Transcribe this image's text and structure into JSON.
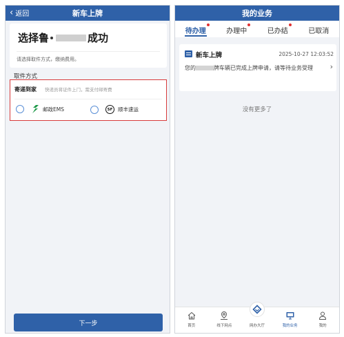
{
  "left": {
    "header": {
      "back_label": "返回",
      "title": "新车上牌"
    },
    "result": {
      "title_prefix": "选择鲁",
      "title_suffix": "成功",
      "subtitle": "请选择取件方式，缴纳费用。"
    },
    "section_label": "取件方式",
    "method": {
      "title": "寄递到家",
      "hint": "快递员将证件上门，需支付邮寄费",
      "options": [
        {
          "label": "邮政EMS",
          "icon": "ems-logo-icon"
        },
        {
          "label": "顺丰速运",
          "icon": "sf-logo-icon",
          "logo_text": "SF"
        }
      ]
    },
    "next_button": "下一步"
  },
  "right": {
    "header": {
      "title": "我的业务"
    },
    "tabs": [
      {
        "label": "待办理",
        "active": true,
        "badge": true
      },
      {
        "label": "办理中",
        "active": false,
        "badge": true
      },
      {
        "label": "已办结",
        "active": false,
        "badge": true
      },
      {
        "label": "已取消",
        "active": false,
        "badge": false
      }
    ],
    "business": {
      "title": "新车上牌",
      "time": "2025-10-27 12:03:52",
      "desc_prefix": "您的",
      "desc_suffix": "牌车辆已完成上牌申请，请等待业务受理"
    },
    "no_more": "没有更多了",
    "nav": [
      {
        "label": "首页",
        "icon": "home-icon"
      },
      {
        "label": "线下网点",
        "icon": "location-pin-icon"
      },
      {
        "label": "网办大厅",
        "icon": "diamond-hall-icon"
      },
      {
        "label": "我的业务",
        "icon": "monitor-icon"
      },
      {
        "label": "我的",
        "icon": "user-icon"
      }
    ]
  },
  "colors": {
    "primary": "#2f61a8",
    "highlight_border": "#d83a3a",
    "badge": "#e03030",
    "ems_green": "#1f9a4a"
  }
}
